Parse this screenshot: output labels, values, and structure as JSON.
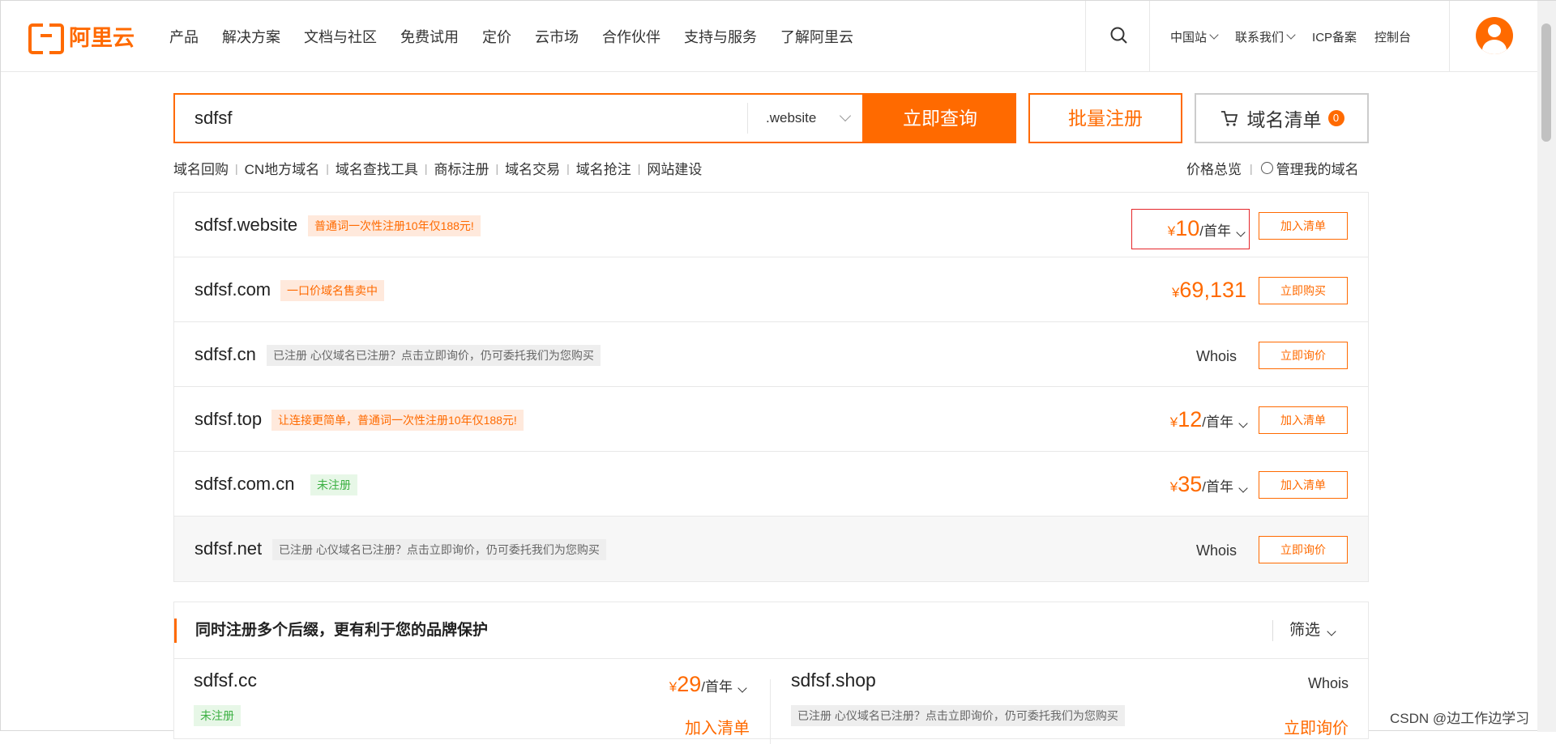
{
  "brand": {
    "name": "阿里云",
    "color": "#ff6a00"
  },
  "nav": {
    "items": [
      "产品",
      "解决方案",
      "文档与社区",
      "免费试用",
      "定价",
      "云市场",
      "合作伙伴",
      "支持与服务",
      "了解阿里云"
    ]
  },
  "topbar": {
    "site": "中国站",
    "contact": "联系我们",
    "icp": "ICP备案",
    "console": "控制台"
  },
  "search": {
    "query": "sdfsf",
    "suffix": ".website",
    "query_button": "立即查询",
    "bulk_button": "批量注册",
    "cart_label": "域名清单",
    "cart_count": "0"
  },
  "sublinks": [
    "域名回购",
    "CN地方域名",
    "域名查找工具",
    "商标注册",
    "域名交易",
    "域名抢注",
    "网站建设"
  ],
  "rightlinks": {
    "price": "价格总览",
    "manage": "管理我的域名"
  },
  "results": [
    {
      "domain": "sdfsf.website",
      "tag": "普通词一次性注册10年仅188元!",
      "tag_style": "orange",
      "price_symbol": "¥",
      "price": "10",
      "unit": "/首年",
      "action": "加入清单"
    },
    {
      "domain": "sdfsf.com",
      "tag": "一口价域名售卖中",
      "tag_style": "orange",
      "price_symbol": "¥",
      "price": "69,131",
      "unit": "",
      "action": "立即购买"
    },
    {
      "domain": "sdfsf.cn",
      "tag": "已注册 心仪域名已注册？点击立即询价，仍可委托我们为您购买",
      "tag_style": "gray",
      "whois": "Whois",
      "action": "立即询价"
    },
    {
      "domain": "sdfsf.top",
      "tag": "让连接更简单，普通词一次性注册10年仅188元!",
      "tag_style": "orange",
      "price_symbol": "¥",
      "price": "12",
      "unit": "/首年",
      "action": "加入清单"
    },
    {
      "domain": "sdfsf.com.cn",
      "tag": "未注册",
      "tag_style": "green",
      "price_symbol": "¥",
      "price": "35",
      "unit": "/首年",
      "action": "加入清单"
    },
    {
      "domain": "sdfsf.net",
      "tag": "已注册 心仪域名已注册？点击立即询价，仍可委托我们为您购买",
      "tag_style": "gray",
      "whois": "Whois",
      "action": "立即询价"
    }
  ],
  "multi": {
    "title": "同时注册多个后缀，更有利于您的品牌保护",
    "filter": "筛选",
    "left": {
      "domain": "sdfsf.cc",
      "tag": "未注册",
      "price_symbol": "¥",
      "price": "29",
      "unit": "/首年",
      "action": "加入清单"
    },
    "right": {
      "domain": "sdfsf.shop",
      "tag": "已注册 心仪域名已注册？点击立即询价，仍可委托我们为您购买",
      "whois": "Whois",
      "action": "立即询价"
    }
  },
  "watermark": "CSDN @边工作边学习"
}
